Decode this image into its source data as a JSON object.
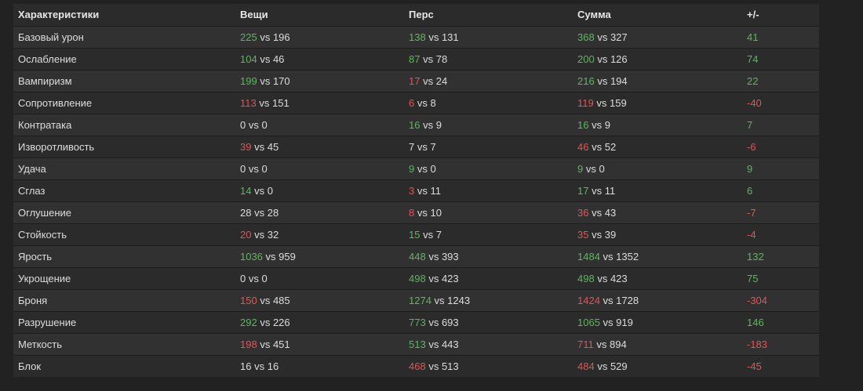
{
  "colors": {
    "background": "#222222",
    "row_odd": "#313131",
    "row_even": "#2b2b2b",
    "positive": "#5cb85c",
    "negative": "#e55353",
    "text": "#dddddd"
  },
  "headers": [
    "Характеристики",
    "Вещи",
    "Перс",
    "Сумма",
    "+/-"
  ],
  "vs_word": "vs",
  "rows": [
    {
      "name": "Базовый урон",
      "items": [
        "225",
        "196",
        "green"
      ],
      "pers": [
        "138",
        "131",
        "green"
      ],
      "sum": [
        "368",
        "327",
        "green"
      ],
      "diff": [
        "41",
        "green"
      ]
    },
    {
      "name": "Ослабление",
      "items": [
        "104",
        "46",
        "green"
      ],
      "pers": [
        "87",
        "78",
        "green"
      ],
      "sum": [
        "200",
        "126",
        "green"
      ],
      "diff": [
        "74",
        "green"
      ]
    },
    {
      "name": "Вампиризм",
      "items": [
        "199",
        "170",
        "green"
      ],
      "pers": [
        "17",
        "24",
        "red"
      ],
      "sum": [
        "216",
        "194",
        "green"
      ],
      "diff": [
        "22",
        "green"
      ]
    },
    {
      "name": "Сопротивление",
      "items": [
        "113",
        "151",
        "red"
      ],
      "pers": [
        "6",
        "8",
        "red"
      ],
      "sum": [
        "119",
        "159",
        "red"
      ],
      "diff": [
        "-40",
        "red"
      ]
    },
    {
      "name": "Контратака",
      "items": [
        "0",
        "0",
        "plain"
      ],
      "pers": [
        "16",
        "9",
        "green"
      ],
      "sum": [
        "16",
        "9",
        "green"
      ],
      "diff": [
        "7",
        "green"
      ]
    },
    {
      "name": "Изворотливость",
      "items": [
        "39",
        "45",
        "red"
      ],
      "pers": [
        "7",
        "7",
        "plain"
      ],
      "sum": [
        "46",
        "52",
        "red"
      ],
      "diff": [
        "-6",
        "red"
      ]
    },
    {
      "name": "Удача",
      "items": [
        "0",
        "0",
        "plain"
      ],
      "pers": [
        "9",
        "0",
        "green"
      ],
      "sum": [
        "9",
        "0",
        "green"
      ],
      "diff": [
        "9",
        "green"
      ]
    },
    {
      "name": "Сглаз",
      "items": [
        "14",
        "0",
        "green"
      ],
      "pers": [
        "3",
        "11",
        "red"
      ],
      "sum": [
        "17",
        "11",
        "green"
      ],
      "diff": [
        "6",
        "green"
      ]
    },
    {
      "name": "Оглушение",
      "items": [
        "28",
        "28",
        "plain"
      ],
      "pers": [
        "8",
        "10",
        "red"
      ],
      "sum": [
        "36",
        "43",
        "red"
      ],
      "diff": [
        "-7",
        "red"
      ]
    },
    {
      "name": "Стойкость",
      "items": [
        "20",
        "32",
        "red"
      ],
      "pers": [
        "15",
        "7",
        "green"
      ],
      "sum": [
        "35",
        "39",
        "red"
      ],
      "diff": [
        "-4",
        "red"
      ]
    },
    {
      "name": "Ярость",
      "items": [
        "1036",
        "959",
        "green"
      ],
      "pers": [
        "448",
        "393",
        "green"
      ],
      "sum": [
        "1484",
        "1352",
        "green"
      ],
      "diff": [
        "132",
        "green"
      ]
    },
    {
      "name": "Укрощение",
      "items": [
        "0",
        "0",
        "plain"
      ],
      "pers": [
        "498",
        "423",
        "green"
      ],
      "sum": [
        "498",
        "423",
        "green"
      ],
      "diff": [
        "75",
        "green"
      ]
    },
    {
      "name": "Броня",
      "items": [
        "150",
        "485",
        "red"
      ],
      "pers": [
        "1274",
        "1243",
        "green"
      ],
      "sum": [
        "1424",
        "1728",
        "red"
      ],
      "diff": [
        "-304",
        "red"
      ]
    },
    {
      "name": "Разрушение",
      "items": [
        "292",
        "226",
        "green"
      ],
      "pers": [
        "773",
        "693",
        "green"
      ],
      "sum": [
        "1065",
        "919",
        "green"
      ],
      "diff": [
        "146",
        "green"
      ]
    },
    {
      "name": "Меткость",
      "items": [
        "198",
        "451",
        "red"
      ],
      "pers": [
        "513",
        "443",
        "green"
      ],
      "sum": [
        "711",
        "894",
        "red"
      ],
      "diff": [
        "-183",
        "red"
      ]
    },
    {
      "name": "Блок",
      "items": [
        "16",
        "16",
        "plain"
      ],
      "pers": [
        "468",
        "513",
        "red"
      ],
      "sum": [
        "484",
        "529",
        "red"
      ],
      "diff": [
        "-45",
        "red"
      ]
    }
  ]
}
